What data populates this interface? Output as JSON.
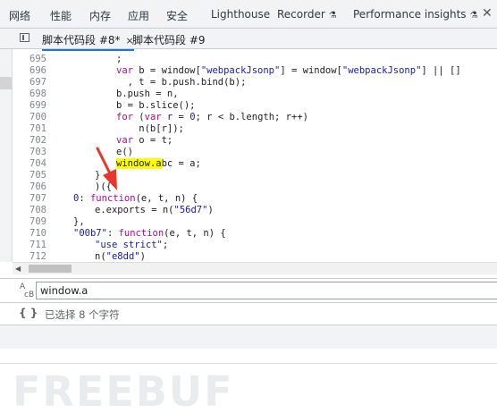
{
  "devtools_tabs": [
    {
      "label": "网络"
    },
    {
      "label": "性能"
    },
    {
      "label": "内存"
    },
    {
      "label": "应用"
    },
    {
      "label": "安全"
    },
    {
      "label": "Lighthouse"
    },
    {
      "label": "Recorder"
    },
    {
      "label": "Performance insights"
    }
  ],
  "file_tabs": [
    {
      "label": "脚本代码段 #8*",
      "active": true,
      "close": "×"
    },
    {
      "label": "脚本代码段 #9",
      "active": false
    }
  ],
  "code_lines": [
    {
      "num": "695",
      "text": ";"
    },
    {
      "num": "696",
      "text": "var b = window[\"webpackJsonp\"] = window[\"webpackJsonp\"] || []"
    },
    {
      "num": "697",
      "text": "  , t = b.push.bind(b);"
    },
    {
      "num": "698",
      "text": "b.push = n,"
    },
    {
      "num": "699",
      "text": "b = b.slice();"
    },
    {
      "num": "700",
      "text": "for (var r = 0; r < b.length; r++)"
    },
    {
      "num": "701",
      "text": "    n(b[r]);"
    },
    {
      "num": "702",
      "text": "var o = t;"
    },
    {
      "num": "703",
      "text": "e()"
    },
    {
      "num": "704",
      "text": "window.abc = a;"
    },
    {
      "num": "705",
      "text": "}"
    },
    {
      "num": "706",
      "text": ")({"
    },
    {
      "num": "707",
      "text": "0: function(e, t, n) {"
    },
    {
      "num": "708",
      "text": "e.exports = n(\"56d7\")"
    },
    {
      "num": "709",
      "text": "},"
    },
    {
      "num": "710",
      "text": "\"00b7\": function(e, t, n) {"
    },
    {
      "num": "711",
      "text": "\"use strict\";"
    },
    {
      "num": "712",
      "text": "n(\"e8dd\")"
    }
  ],
  "search": {
    "value": "window.a",
    "icon": "match-case-icon"
  },
  "status": {
    "text": "已选择 8 个字符",
    "icon": "pretty-print-braces-icon"
  },
  "watermark": "FREEBUF",
  "colors": {
    "highlight": "#ffff00",
    "keyword": "#aa0d91",
    "string": "#1a1aa6",
    "arrow": "#e8362a"
  }
}
